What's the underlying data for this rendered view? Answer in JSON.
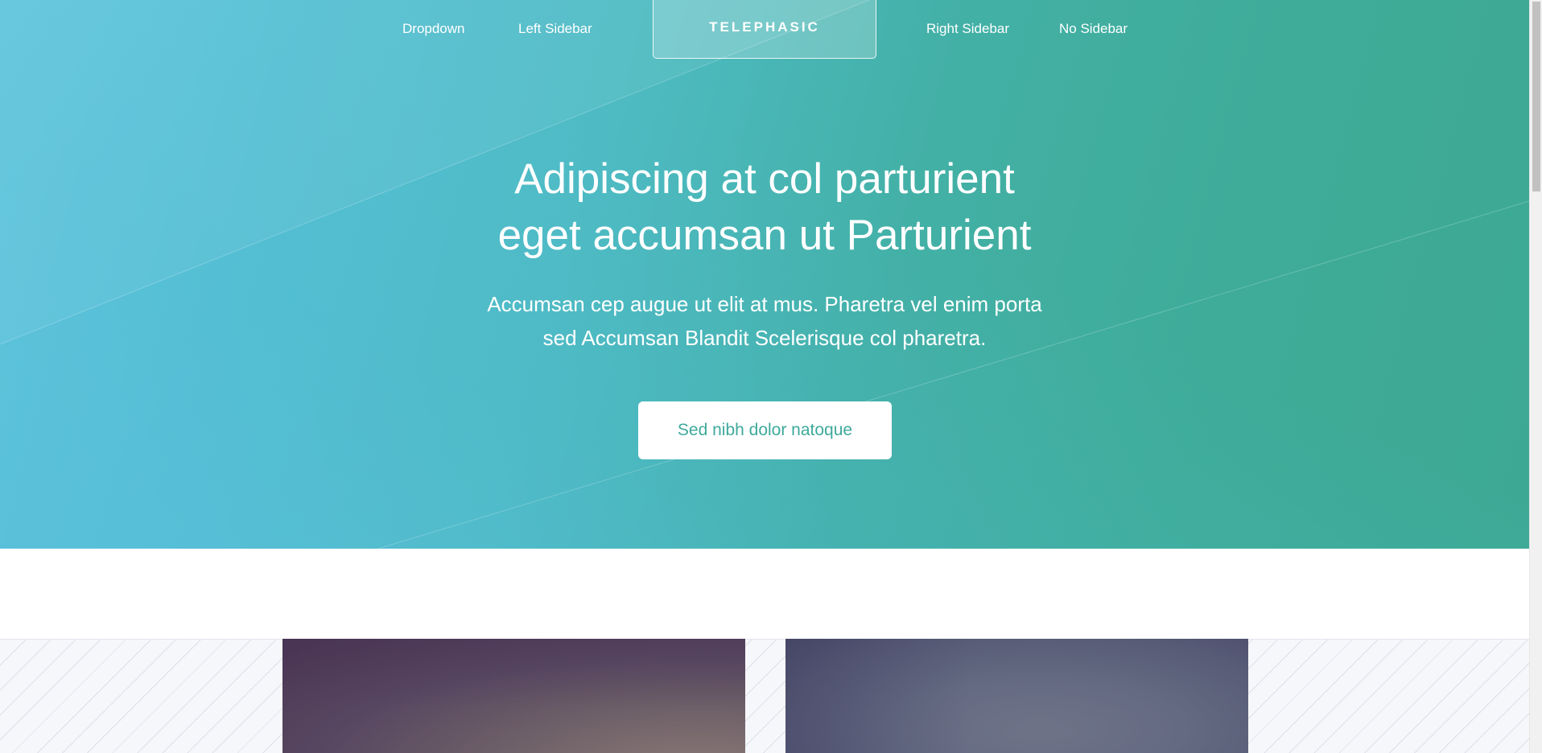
{
  "nav": {
    "left_links": [
      "Dropdown",
      "Left Sidebar"
    ],
    "logo": "TELEPHASIC",
    "right_links": [
      "Right Sidebar",
      "No Sidebar"
    ]
  },
  "hero": {
    "headline_lines": [
      "Adipiscing at col parturient",
      "eget accumsan ut Parturient"
    ],
    "subline_lines": [
      "Accumsan cep augue ut elit at mus. Pharetra vel enim porta",
      "sed Accumsan Blandit Scelerisque col pharetra."
    ],
    "cta_label": "Sed nibh dolor natoque"
  },
  "colors": {
    "hero_start": "#62c7de",
    "hero_end": "#3da995",
    "cta_text": "#3ea99c",
    "pattern_bg": "#f6f7fa"
  }
}
